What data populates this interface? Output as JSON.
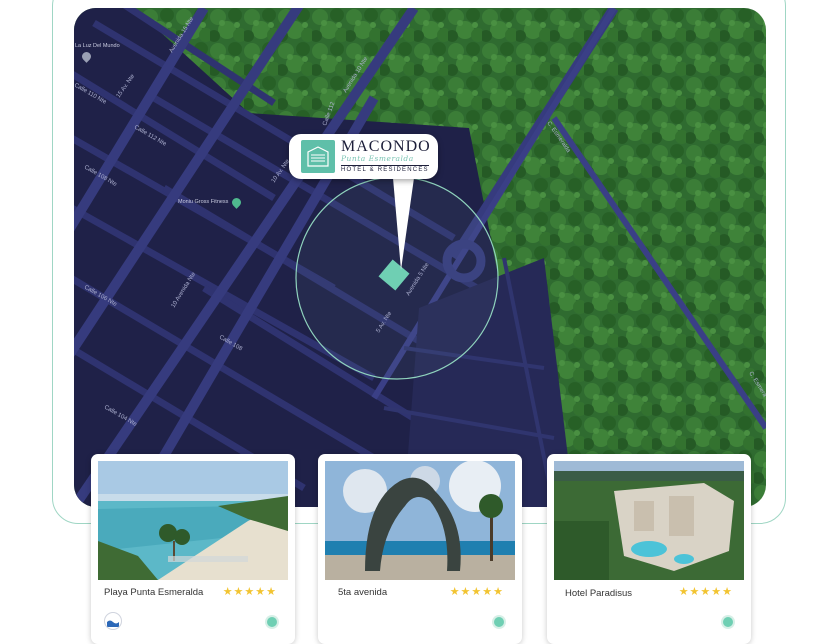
{
  "map": {
    "streets": [
      "Avenida 15 Nte",
      "Avenida 10 Nte",
      "Calle 112",
      "Calle 110 Nte",
      "15 Av. Nte",
      "Calle 112 Nte",
      "10 Av. Nte",
      "Calle 108 Nte",
      "10 Avenida Nte",
      "Calle 108",
      "Avenida 5 Nte",
      "5 Av. Nte",
      "Calle 106 Nte",
      "Calle 104 Nte",
      "C. Esmeralda",
      "C. Esmera"
    ],
    "pois": [
      {
        "label": "La Luz Del Mundo",
        "icon": "place-pin-icon",
        "color": "#9aa0b4"
      },
      {
        "label": "Moniu Gross Fitness",
        "icon": "gym-pin-icon",
        "color": "#4fb98e"
      }
    ],
    "colors": {
      "land": "#1f2148",
      "road": "#35397a",
      "forest": "#2e6a2f",
      "accent": "#9fd6c4"
    }
  },
  "marker": {
    "title": "MACONDO",
    "script": "Punta Esmeralda",
    "subtitle": "HOTEL & RESIDENCES",
    "icon": "hotel-building-icon"
  },
  "cards": [
    {
      "name": "Playa Punta Esmeralda",
      "stars": "★★★★★",
      "rating": 5,
      "badge_icon": "wave-icon"
    },
    {
      "name": "5ta avenida",
      "stars": "★★★★★",
      "rating": 5
    },
    {
      "name": "Hotel Paradisus",
      "stars": "★★★★★",
      "rating": 5
    }
  ]
}
